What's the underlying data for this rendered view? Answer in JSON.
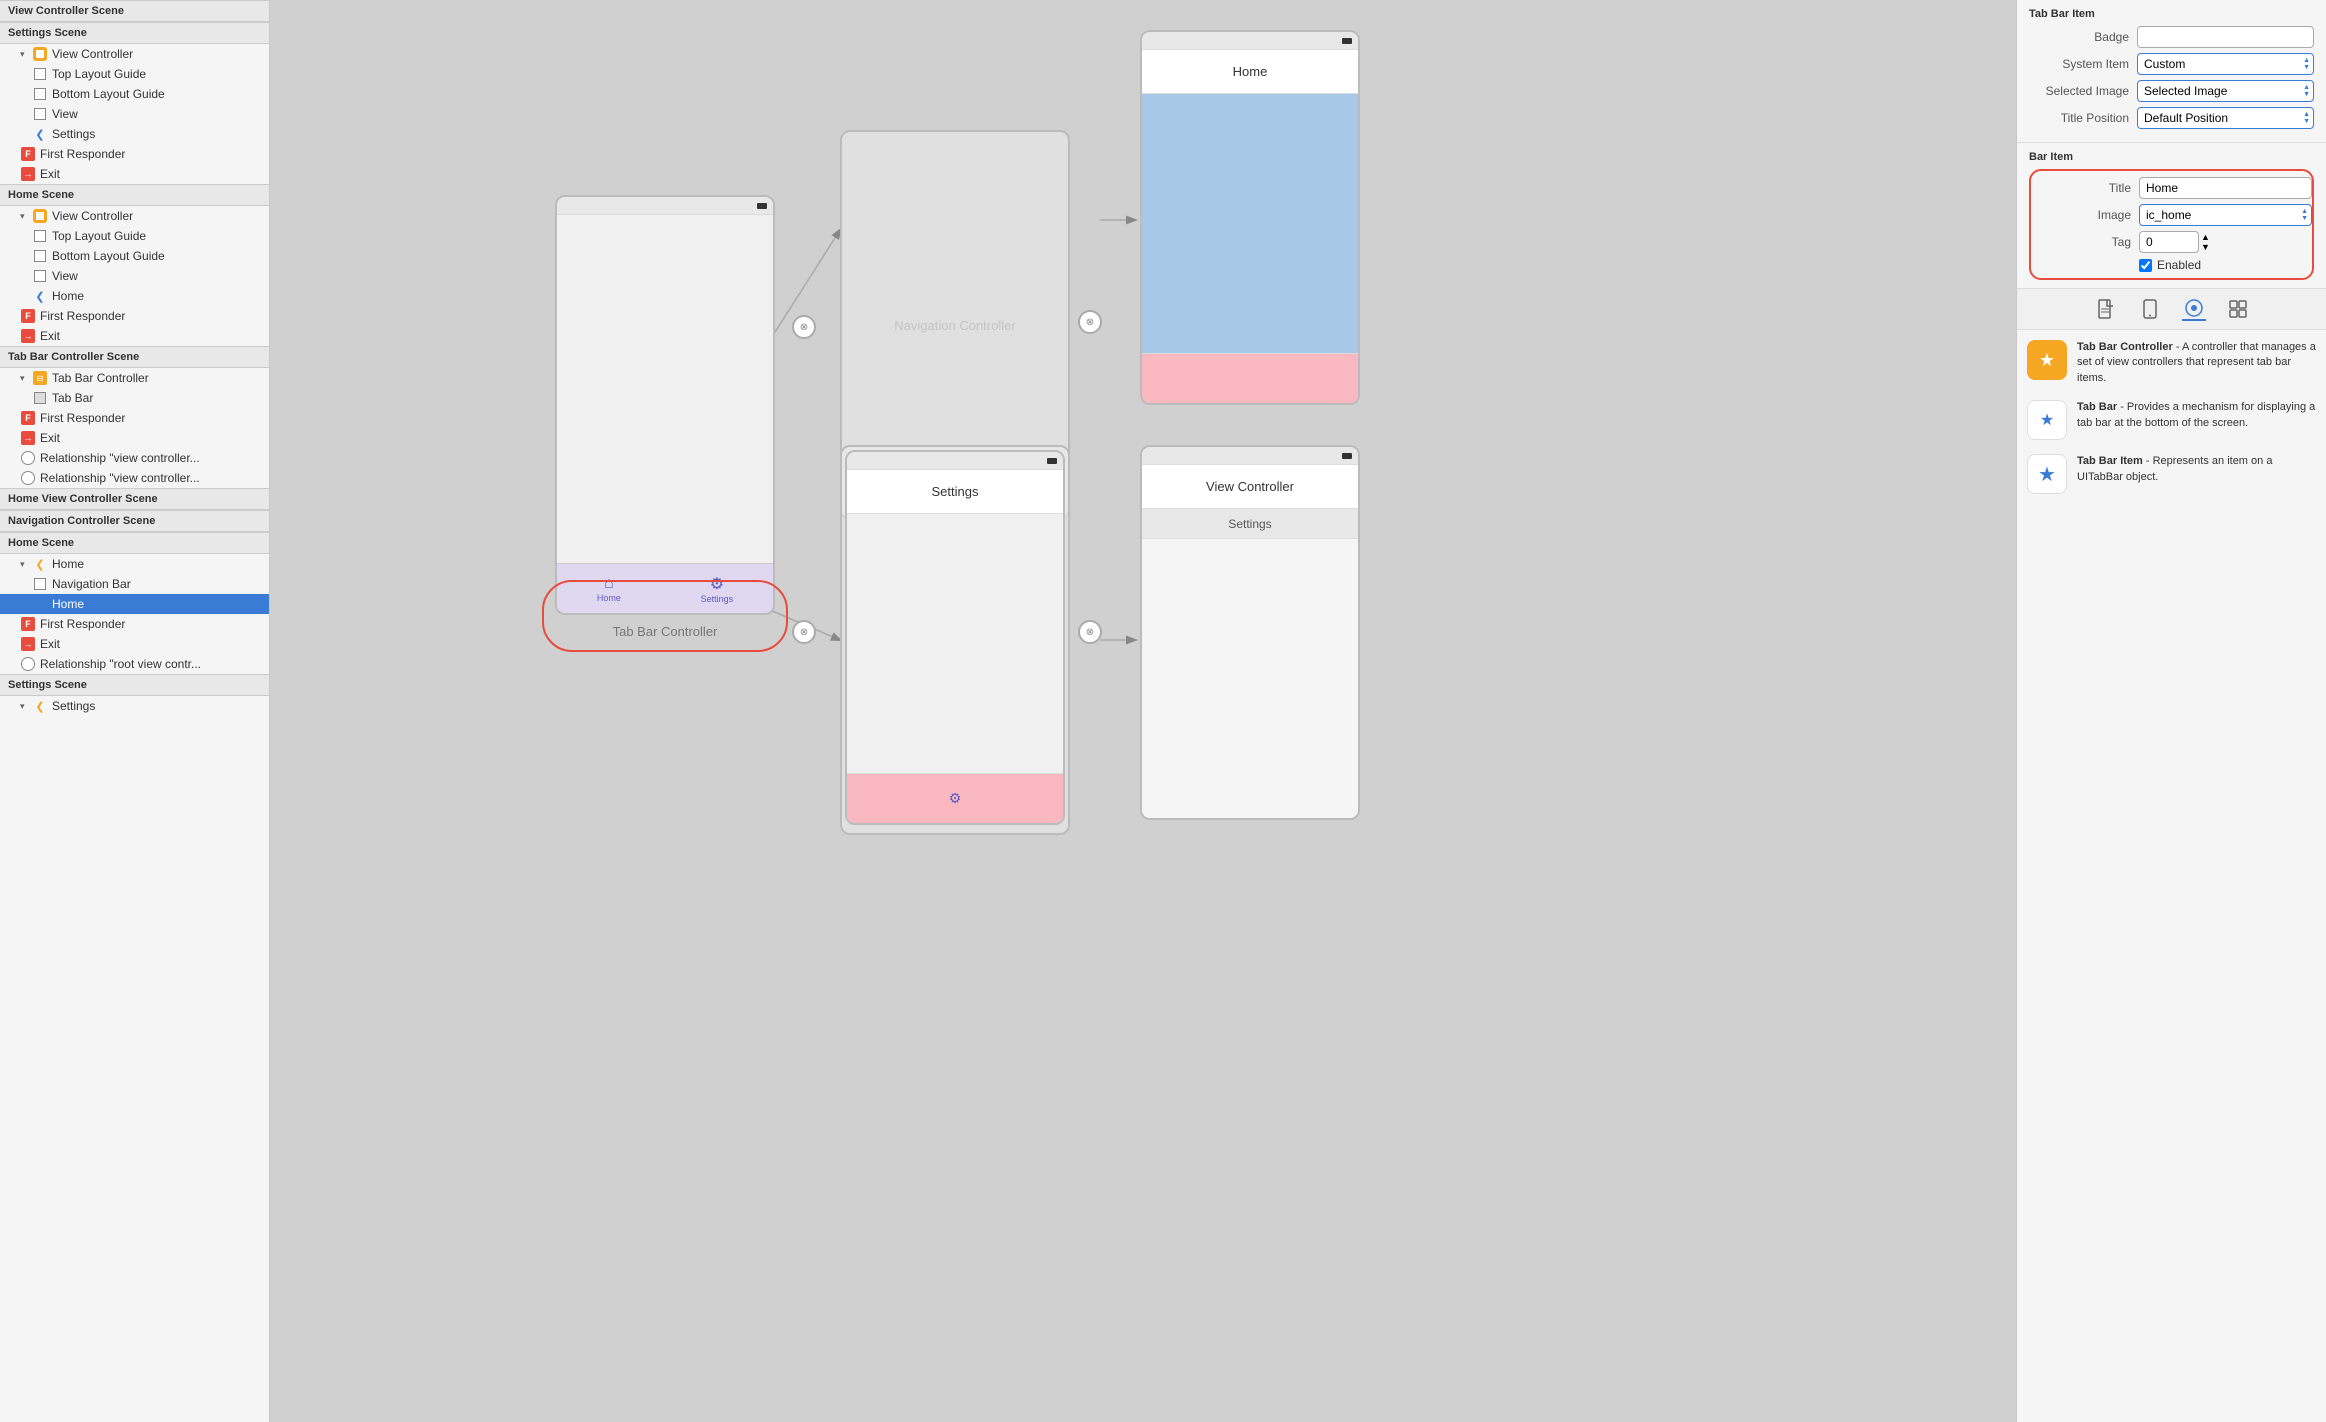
{
  "leftPanel": {
    "sections": [
      {
        "id": "view-controller-scene",
        "header": "View Controller Scene",
        "items": []
      },
      {
        "id": "settings-scene",
        "header": "Settings Scene",
        "items": [
          {
            "id": "vc-settings",
            "label": "View Controller",
            "indent": 2,
            "type": "vc",
            "disclosure": "▾"
          },
          {
            "id": "top-layout-settings",
            "label": "Top Layout Guide",
            "indent": 3,
            "type": "layout"
          },
          {
            "id": "bottom-layout-settings",
            "label": "Bottom Layout Guide",
            "indent": 3,
            "type": "layout"
          },
          {
            "id": "view-settings",
            "label": "View",
            "indent": 3,
            "type": "view"
          },
          {
            "id": "settings-nav",
            "label": "Settings",
            "indent": 3,
            "type": "nav"
          },
          {
            "id": "first-settings",
            "label": "First Responder",
            "indent": 2,
            "type": "first"
          },
          {
            "id": "exit-settings",
            "label": "Exit",
            "indent": 2,
            "type": "exit"
          }
        ]
      },
      {
        "id": "home-scene",
        "header": "Home Scene",
        "items": [
          {
            "id": "vc-home",
            "label": "View Controller",
            "indent": 2,
            "type": "vc",
            "disclosure": "▾"
          },
          {
            "id": "top-layout-home",
            "label": "Top Layout Guide",
            "indent": 3,
            "type": "layout"
          },
          {
            "id": "bottom-layout-home",
            "label": "Bottom Layout Guide",
            "indent": 3,
            "type": "layout"
          },
          {
            "id": "view-home",
            "label": "View",
            "indent": 3,
            "type": "view"
          },
          {
            "id": "home-nav",
            "label": "Home",
            "indent": 3,
            "type": "nav"
          },
          {
            "id": "first-home",
            "label": "First Responder",
            "indent": 2,
            "type": "first"
          },
          {
            "id": "exit-home",
            "label": "Exit",
            "indent": 2,
            "type": "exit"
          }
        ]
      },
      {
        "id": "tab-bar-controller-scene",
        "header": "Tab Bar Controller Scene",
        "items": [
          {
            "id": "tbc",
            "label": "Tab Bar Controller",
            "indent": 2,
            "type": "tbc",
            "disclosure": "▾"
          },
          {
            "id": "tab-bar",
            "label": "Tab Bar",
            "indent": 3,
            "type": "tabbar"
          },
          {
            "id": "first-tbc",
            "label": "First Responder",
            "indent": 2,
            "type": "first"
          },
          {
            "id": "exit-tbc",
            "label": "Exit",
            "indent": 2,
            "type": "exit"
          },
          {
            "id": "rel1",
            "label": "Relationship \"view controller...",
            "indent": 2,
            "type": "rel"
          },
          {
            "id": "rel2",
            "label": "Relationship \"view controller...",
            "indent": 2,
            "type": "rel"
          }
        ]
      },
      {
        "id": "home-vc-scene",
        "header": "Home View Controller Scene",
        "items": []
      },
      {
        "id": "nav-controller-scene",
        "header": "Navigation Controller Scene",
        "items": []
      },
      {
        "id": "home-scene-2",
        "header": "Home Scene",
        "items": [
          {
            "id": "home-2",
            "label": "Home",
            "indent": 2,
            "type": "home-back",
            "disclosure": "▾"
          },
          {
            "id": "nav-bar",
            "label": "Navigation Bar",
            "indent": 3,
            "type": "layout"
          },
          {
            "id": "home-star",
            "label": "Home",
            "indent": 3,
            "type": "star",
            "selected": true
          },
          {
            "id": "first-home2",
            "label": "First Responder",
            "indent": 2,
            "type": "first"
          },
          {
            "id": "exit-home2",
            "label": "Exit",
            "indent": 2,
            "type": "exit"
          },
          {
            "id": "rel-root",
            "label": "Relationship \"root view contr...",
            "indent": 2,
            "type": "rel"
          }
        ]
      },
      {
        "id": "settings-scene-2",
        "header": "Settings Scene",
        "items": [
          {
            "id": "settings-2",
            "label": "Settings",
            "indent": 2,
            "type": "home-back"
          }
        ]
      }
    ]
  },
  "canvas": {
    "tabBarController": {
      "label": "Tab Bar Controller",
      "tabBarLabel1": "Home",
      "tabBarLabel2": "Settings"
    },
    "navController1": {
      "label": "Navigation Controller"
    },
    "navController2": {
      "label": "Navigation Controller"
    },
    "homeScene": {
      "title": "Home",
      "tabBarLabel": "Home"
    },
    "settingsScene": {
      "title": "Settings",
      "tabBarLabel": "Settings"
    },
    "vcSettings": {
      "title": "View Controller",
      "subtitle": "Settings"
    }
  },
  "rightPanel": {
    "tabBarItem": {
      "sectionTitle": "Tab Bar Item",
      "badgeLabel": "Badge",
      "systemItemLabel": "System Item",
      "systemItemValue": "Custom",
      "selectedImageLabel": "Selected Image",
      "selectedImageValue": "Selected Image",
      "titlePositionLabel": "Title Position",
      "titlePositionValue": "Default Position"
    },
    "barItem": {
      "sectionTitle": "Bar Item",
      "titleLabel": "Title",
      "titleValue": "Home",
      "imageLabel": "Image",
      "imageValue": "ic_home",
      "tagLabel": "Tag",
      "tagValue": "0",
      "enabledLabel": "Enabled"
    },
    "tabs": [
      {
        "id": "file-icon",
        "label": "📄",
        "active": false
      },
      {
        "id": "phone-icon",
        "label": "📱",
        "active": false
      },
      {
        "id": "circle-icon",
        "label": "⊙",
        "active": true
      },
      {
        "id": "grid-icon",
        "label": "⊞",
        "active": false
      }
    ],
    "helpItems": [
      {
        "id": "tbc-help",
        "iconType": "tbc",
        "iconText": "★",
        "title": "Tab Bar Controller",
        "desc": "- A controller that manages a set of view controllers that represent tab bar items."
      },
      {
        "id": "tab-help",
        "iconType": "tab",
        "iconText": "★",
        "title": "Tab Bar",
        "desc": "- Provides a mechanism for displaying a tab bar at the bottom of the screen."
      },
      {
        "id": "tbi-help",
        "iconType": "tbi",
        "iconText": "★",
        "title": "Tab Bar Item",
        "desc": "- Represents an item on a UITabBar object."
      }
    ]
  }
}
